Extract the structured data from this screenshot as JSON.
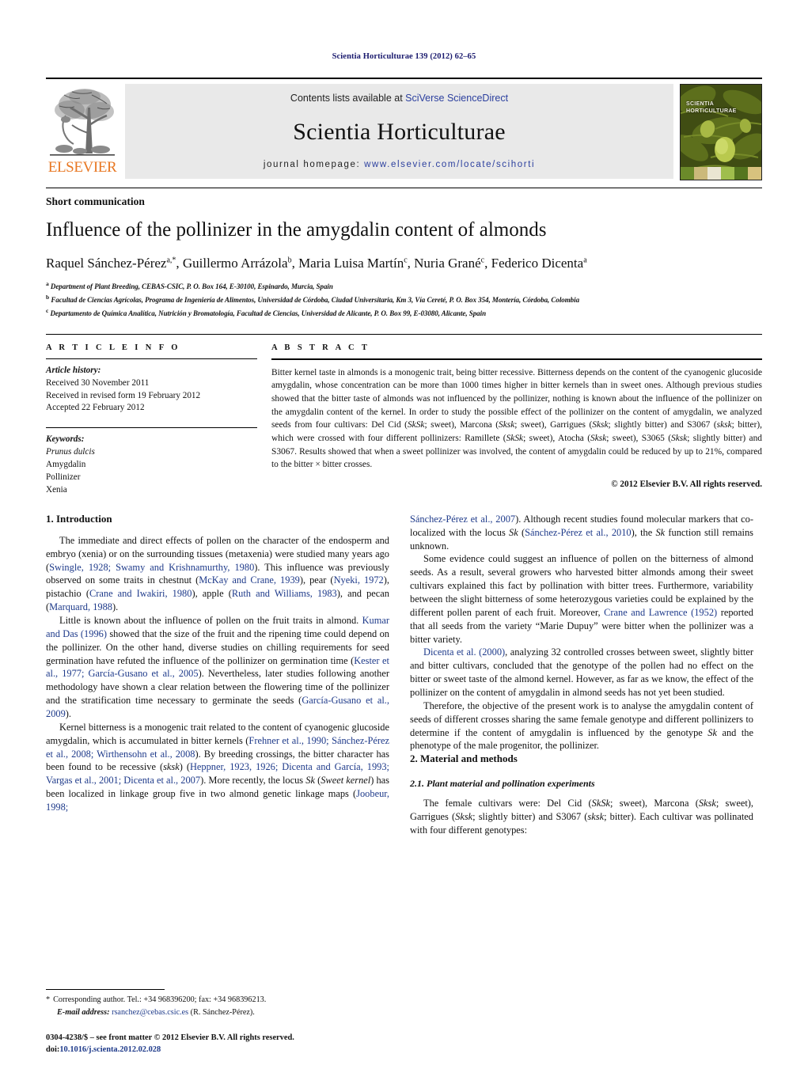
{
  "running_head": "Scientia Horticulturae 139 (2012) 62–65",
  "masthead": {
    "contents_prefix": "Contents lists available at ",
    "contents_link": "SciVerse ScienceDirect",
    "journal_name": "Scientia Horticulturae",
    "homepage_prefix": "journal homepage: ",
    "homepage_url": "www.elsevier.com/locate/scihorti",
    "publisher": "ELSEVIER",
    "cover_title_line1": "SCIENTIA",
    "cover_title_line2": "HORTICULTURAE",
    "link_color": "#2b3f9e",
    "publisher_color": "#e87722"
  },
  "article": {
    "doc_type": "Short communication",
    "title": "Influence of the pollinizer in the amygdalin content of almonds",
    "authors_html": "Raquel Sánchez-Pérez<sup>a,*</sup>, Guillermo Arrázola<sup>b</sup>, Maria Luisa Martín<sup>c</sup>, Nuria Grané<sup>c</sup>, Federico Dicenta<sup>a</sup>",
    "affiliations": [
      "Department of Plant Breeding, CEBAS-CSIC, P. O. Box 164, E-30100, Espinardo, Murcia, Spain",
      "Facultad de Ciencias Agrícolas, Programa de Ingeniería de Alimentos, Universidad de Córdoba, Ciudad Universitaria, Km 3, Vía Cereté, P. O. Box 354, Montería, Córdoba, Colombia",
      "Departamento de Química Analítica, Nutrición y Bromatología, Facultad de Ciencias, Universidad de Alicante, P. O. Box 99, E-03080, Alicante, Spain"
    ],
    "affil_markers": [
      "a",
      "b",
      "c"
    ]
  },
  "article_info": {
    "heading": "A R T I C L E    I N F O",
    "history_label": "Article history:",
    "history": [
      "Received 30 November 2011",
      "Received in revised form 19 February 2012",
      "Accepted 22 February 2012"
    ],
    "keywords_label": "Keywords:",
    "keywords": [
      "Prunus dulcis",
      "Amygdalin",
      "Pollinizer",
      "Xenia"
    ],
    "keyword_italic_index": 0
  },
  "abstract": {
    "heading": "A B S T R A C T",
    "text_html": "Bitter kernel taste in almonds is a monogenic trait, being bitter recessive. Bitterness depends on the content of the cyanogenic glucoside amygdalin, whose concentration can be more than 1000 times higher in bitter kernels than in sweet ones. Although previous studies showed that the bitter taste of almonds was not influenced by the pollinizer, nothing is known about the influence of the pollinizer on the amygdalin content of the kernel. In order to study the possible effect of the pollinizer on the content of amygdalin, we analyzed seeds from four cultivars: Del Cid (<i>SkSk</i>; sweet), Marcona (<i>Sksk</i>; sweet), Garrigues (<i>Sksk</i>; slightly bitter) and S3067 (<i>sksk</i>; bitter), which were crossed with four different pollinizers: Ramillete (<i>SkSk</i>; sweet), Atocha (<i>Sksk</i>; sweet), S3065 (<i>Sksk</i>; slightly bitter) and S3067. Results showed that when a sweet pollinizer was involved, the content of amygdalin could be reduced by up to 21%, compared to the bitter × bitter crosses.",
    "copyright": "© 2012 Elsevier B.V. All rights reserved."
  },
  "body": {
    "left_column": [
      {
        "type": "h2",
        "text": "1.  Introduction"
      },
      {
        "type": "p",
        "html": "The immediate and direct effects of pollen on the character of the endosperm and embryo (xenia) or on the surrounding tissues (metaxenia) were studied many years ago (<span class=\"ref\">Swingle, 1928; Swamy and Krishnamurthy, 1980</span>). This influence was previously observed on some traits in chestnut (<span class=\"ref\">McKay and Crane, 1939</span>), pear (<span class=\"ref\">Nyeki, 1972</span>), pistachio (<span class=\"ref\">Crane and Iwakiri, 1980</span>), apple (<span class=\"ref\">Ruth and Williams, 1983</span>), and pecan (<span class=\"ref\">Marquard, 1988</span>)."
      },
      {
        "type": "p",
        "html": "Little is known about the influence of pollen on the fruit traits in almond. <span class=\"ref\">Kumar and Das (1996)</span> showed that the size of the fruit and the ripening time could depend on the pollinizer. On the other hand, diverse studies on chilling requirements for seed germination have refuted the influence of the pollinizer on germination time (<span class=\"ref\">Kester et al., 1977; García-Gusano et al., 2005</span>). Nevertheless, later studies following another methodology have shown a clear relation between the flowering time of the pollinizer and the stratification time necessary to germinate the seeds (<span class=\"ref\">García-Gusano et al., 2009</span>)."
      },
      {
        "type": "p",
        "html": "Kernel bitterness is a monogenic trait related to the content of cyanogenic glucoside amygdalin, which is accumulated in bitter kernels (<span class=\"ref\">Frehner et al., 1990; Sánchez-Pérez et al., 2008; Wirthensohn et al., 2008</span>). By breeding crossings, the bitter character has been found to be recessive (<i>sksk</i>) (<span class=\"ref\">Heppner, 1923, 1926; Dicenta and García, 1993; Vargas et al., 2001; Dicenta et al., 2007</span>). More recently, the locus <i>Sk</i> (<i>Sweet kernel</i>) has been localized in linkage group five in two almond genetic linkage maps (<span class=\"ref\">Joobeur, 1998;</span>"
      }
    ],
    "right_column": [
      {
        "type": "p_nofirst",
        "html": "<span class=\"ref\">Sánchez-Pérez et al., 2007</span>). Although recent studies found molecular markers that co-localized with the locus <i>Sk</i> (<span class=\"ref\">Sánchez-Pérez et al., 2010</span>), the <i>Sk</i> function still remains unknown."
      },
      {
        "type": "p",
        "html": "Some evidence could suggest an influence of pollen on the bitterness of almond seeds. As a result, several growers who harvested bitter almonds among their sweet cultivars explained this fact by pollination with bitter trees. Furthermore, variability between the slight bitterness of some heterozygous varieties could be explained by the different pollen parent of each fruit. Moreover, <span class=\"ref\">Crane and Lawrence (1952)</span> reported that all seeds from the variety “Marie Dupuy” were bitter when the pollinizer was a bitter variety."
      },
      {
        "type": "p",
        "html": "<span class=\"ref\">Dicenta et al. (2000)</span>, analyzing 32 controlled crosses between sweet, slightly bitter and bitter cultivars, concluded that the genotype of the pollen had no effect on the bitter or sweet taste of the almond kernel. However, as far as we know, the effect of the pollinizer on the content of amygdalin in almond seeds has not yet been studied."
      },
      {
        "type": "p",
        "html": "Therefore, the objective of the present work is to analyse the amygdalin content of seeds of different crosses sharing the same female genotype and different pollinizers to determine if the content of amygdalin is influenced by the genotype <i>Sk</i> and the phenotype of the male progenitor, the pollinizer."
      },
      {
        "type": "h2",
        "text": "2.  Material and methods"
      },
      {
        "type": "h3",
        "text": "2.1.  Plant material and pollination experiments"
      },
      {
        "type": "p",
        "html": "The female cultivars were: Del Cid (<i>SkSk</i>; sweet), Marcona (<i>Sksk</i>; sweet), Garrigues (<i>Sksk</i>; slightly bitter) and S3067 (<i>sksk</i>; bitter). Each cultivar was pollinated with four different genotypes:"
      }
    ]
  },
  "footnote": {
    "star": "*",
    "corresponding": "Corresponding author. Tel.: +34 968396200; fax: +34 968396213.",
    "email_label": "E-mail address:",
    "email": "rsanchez@cebas.csic.es",
    "email_suffix": "(R. Sánchez-Pérez)."
  },
  "imprint": {
    "line1": "0304-4238/$ – see front matter © 2012 Elsevier B.V. All rights reserved.",
    "doi_prefix": "doi:",
    "doi": "10.1016/j.scienta.2012.02.028"
  }
}
